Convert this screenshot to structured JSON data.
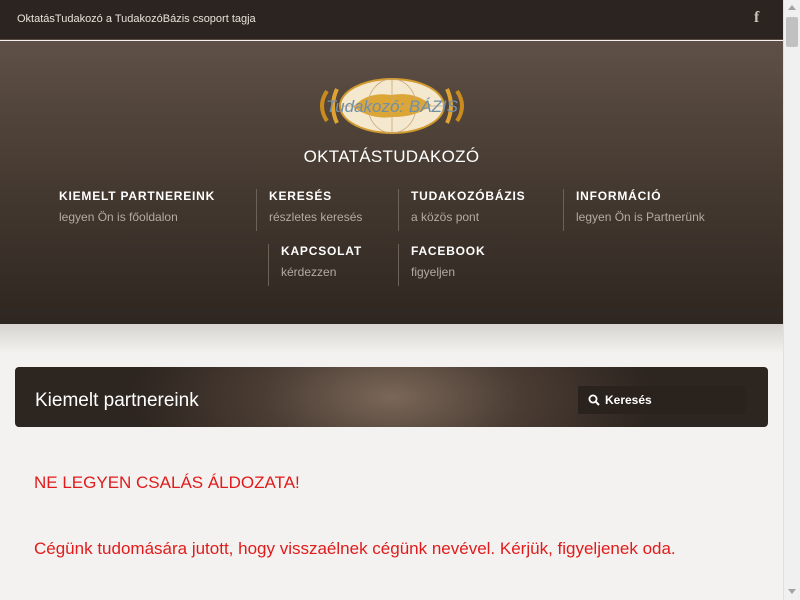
{
  "topbar": {
    "tagline": "OktatásTudakozó a TudakozóBázis csoport tagja",
    "facebook_icon": "f"
  },
  "header": {
    "logo_text": "Tudakozó: BÁZIS",
    "site_title": "OKTATÁSTUDAKOZÓ"
  },
  "nav": {
    "items": [
      {
        "label": "KIEMELT PARTNEREINK",
        "sub": "legyen Ön is főoldalon"
      },
      {
        "label": "KERESÉS",
        "sub": "részletes keresés"
      },
      {
        "label": "TUDAKOZÓBÁZIS",
        "sub": "a közös pont"
      },
      {
        "label": "INFORMÁCIÓ",
        "sub": "legyen Ön is Partnerünk"
      },
      {
        "label": "KAPCSOLAT",
        "sub": "kérdezzen"
      },
      {
        "label": "FACEBOOK",
        "sub": "figyeljen"
      }
    ]
  },
  "section": {
    "title": "Kiemelt partnereink",
    "search_label": "Keresés"
  },
  "content": {
    "alert_title": "NE LEGYEN CSALÁS ÁLDOZATA!",
    "alert_body": "Cégünk tudomására jutott, hogy visszaélnek cégünk nevével. Kérjük, figyeljenek oda."
  },
  "colors": {
    "accent_red": "#e01b1b",
    "header_dark": "#2b2420"
  }
}
